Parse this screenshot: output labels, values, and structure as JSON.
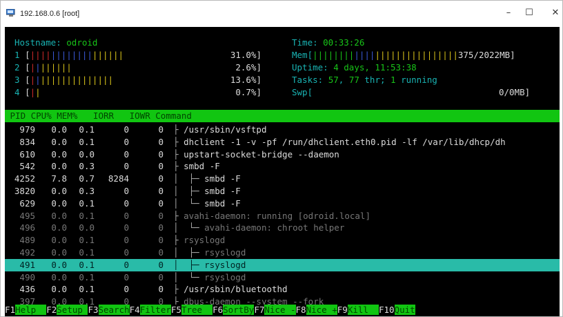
{
  "window": {
    "title": "192.168.0.6 [root]",
    "minimize": "–",
    "maximize": "☐",
    "close": "✕"
  },
  "header": {
    "hostname_label": "Hostname: ",
    "hostname": "odroid",
    "time_label": "Time: ",
    "time": "00:33:26",
    "mem_label": "Mem[",
    "mem_value": "375/2022MB]",
    "uptime_label": "Uptime: ",
    "uptime": "4 days, 11:53:38",
    "tasks_label": "Tasks: ",
    "tasks_count": "57",
    "tasks_sep": ", ",
    "threads": "77",
    "threads_label": " thr; ",
    "running": "1",
    "running_label": " running",
    "swp_label": "Swp[",
    "swp_value": "0/0MB]"
  },
  "cpus": [
    {
      "id": "1",
      "percent": "31.0%]",
      "red": "||||",
      "blue": "||||||||",
      "yellow": "||||||"
    },
    {
      "id": "2",
      "percent": "2.6%]",
      "red": "|",
      "blue": "|",
      "yellow": "||||||"
    },
    {
      "id": "3",
      "percent": "13.6%]",
      "red": "|",
      "blue": "|",
      "yellow": "||||||||||||||"
    },
    {
      "id": "4",
      "percent": "0.7%]",
      "red": "|",
      "blue": "",
      "yellow": "|"
    }
  ],
  "columns": " PID CPU% MEM%   IORR   IOWR Command",
  "processes": [
    {
      "pid": "979",
      "cpu": "0.0",
      "mem": "0.1",
      "iorr": "0",
      "iowr": "0",
      "tree": "├ ",
      "cmd": "/usr/sbin/vsftpd",
      "dim": false,
      "selected": false
    },
    {
      "pid": "834",
      "cpu": "0.0",
      "mem": "0.1",
      "iorr": "0",
      "iowr": "0",
      "tree": "├ ",
      "cmd": "dhclient -1 -v -pf /run/dhclient.eth0.pid -lf /var/lib/dhcp/dh",
      "dim": false,
      "selected": false
    },
    {
      "pid": "610",
      "cpu": "0.0",
      "mem": "0.0",
      "iorr": "0",
      "iowr": "0",
      "tree": "├ ",
      "cmd": "upstart-socket-bridge --daemon",
      "dim": false,
      "selected": false
    },
    {
      "pid": "542",
      "cpu": "0.0",
      "mem": "0.3",
      "iorr": "0",
      "iowr": "0",
      "tree": "├ ",
      "cmd": "smbd -F",
      "dim": false,
      "selected": false
    },
    {
      "pid": "4252",
      "cpu": "7.8",
      "mem": "0.7",
      "iorr": "8284",
      "iowr": "0",
      "tree": "│  ├─ ",
      "cmd": "smbd -F",
      "dim": false,
      "selected": false
    },
    {
      "pid": "3820",
      "cpu": "0.0",
      "mem": "0.3",
      "iorr": "0",
      "iowr": "0",
      "tree": "│  ├─ ",
      "cmd": "smbd -F",
      "dim": false,
      "selected": false
    },
    {
      "pid": "629",
      "cpu": "0.0",
      "mem": "0.1",
      "iorr": "0",
      "iowr": "0",
      "tree": "│  └─ ",
      "cmd": "smbd -F",
      "dim": false,
      "selected": false
    },
    {
      "pid": "495",
      "cpu": "0.0",
      "mem": "0.1",
      "iorr": "0",
      "iowr": "0",
      "tree": "├ ",
      "cmd": "avahi-daemon: running [odroid.local]",
      "dim": true,
      "selected": false
    },
    {
      "pid": "496",
      "cpu": "0.0",
      "mem": "0.0",
      "iorr": "0",
      "iowr": "0",
      "tree": "│  └─ ",
      "cmd": "avahi-daemon: chroot helper",
      "dim": true,
      "selected": false
    },
    {
      "pid": "489",
      "cpu": "0.0",
      "mem": "0.1",
      "iorr": "0",
      "iowr": "0",
      "tree": "├ ",
      "cmd": "rsyslogd",
      "dim": true,
      "selected": false
    },
    {
      "pid": "492",
      "cpu": "0.0",
      "mem": "0.1",
      "iorr": "0",
      "iowr": "0",
      "tree": "│  ├─ ",
      "cmd": "rsyslogd",
      "dim": true,
      "selected": false
    },
    {
      "pid": "491",
      "cpu": "0.0",
      "mem": "0.1",
      "iorr": "0",
      "iowr": "0",
      "tree": "│  ├─ ",
      "cmd": "rsyslogd",
      "dim": false,
      "selected": true
    },
    {
      "pid": "490",
      "cpu": "0.0",
      "mem": "0.1",
      "iorr": "0",
      "iowr": "0",
      "tree": "│  └─ ",
      "cmd": "rsyslogd",
      "dim": true,
      "selected": false
    },
    {
      "pid": "436",
      "cpu": "0.0",
      "mem": "0.1",
      "iorr": "0",
      "iowr": "0",
      "tree": "├ ",
      "cmd": "/usr/sbin/bluetoothd",
      "dim": false,
      "selected": false
    },
    {
      "pid": "397",
      "cpu": "0.0",
      "mem": "0.1",
      "iorr": "0",
      "iowr": "0",
      "tree": "├ ",
      "cmd": "dbus-daemon --system --fork",
      "dim": true,
      "selected": false
    }
  ],
  "function_keys": [
    {
      "key": "F1",
      "label": "Help  "
    },
    {
      "key": "F2",
      "label": "Setup "
    },
    {
      "key": "F3",
      "label": "Search"
    },
    {
      "key": "F4",
      "label": "Filter"
    },
    {
      "key": "F5",
      "label": "Tree  "
    },
    {
      "key": "F6",
      "label": "SortBy"
    },
    {
      "key": "F7",
      "label": "Nice -"
    },
    {
      "key": "F8",
      "label": "Nice +"
    },
    {
      "key": "F9",
      "label": "Kill  "
    },
    {
      "key": "F10",
      "label": "Quit"
    }
  ],
  "colors": {
    "header_bar": "#11c511",
    "selected_row": "#29bba8",
    "label_cyan": "#19b3b3"
  }
}
